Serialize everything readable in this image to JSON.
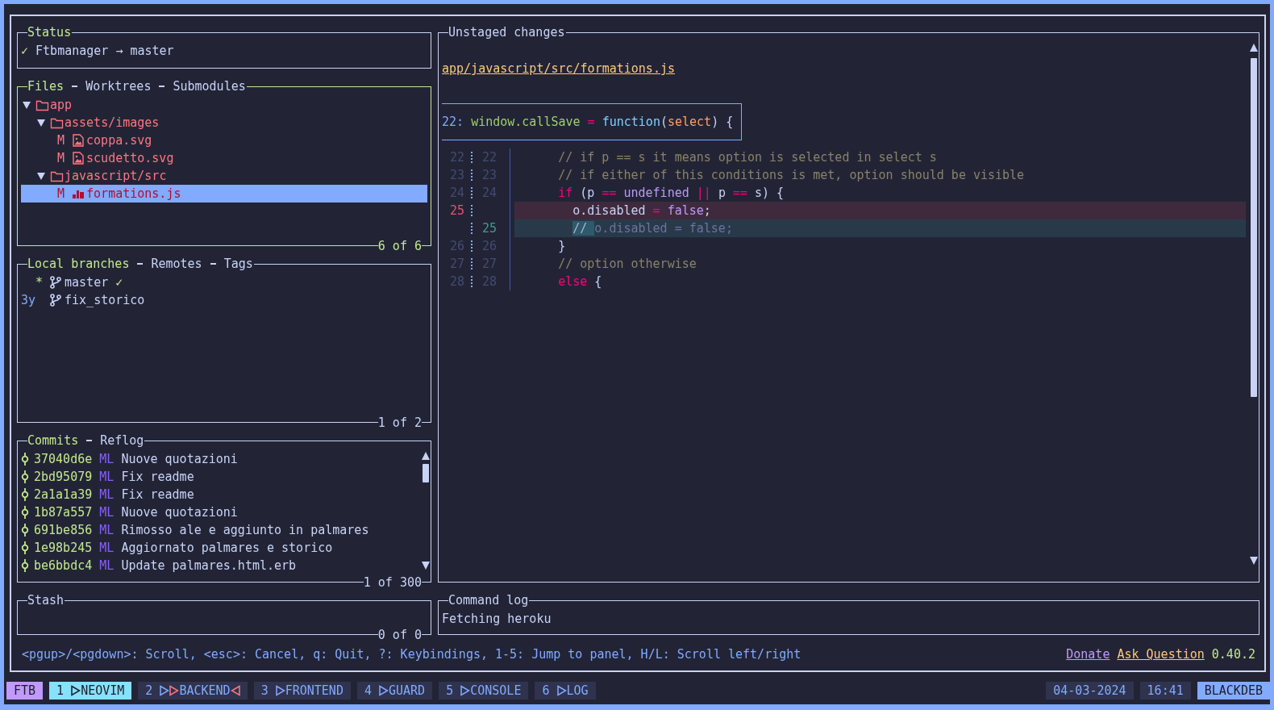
{
  "status_panel": {
    "tabs": [
      {
        "label": "Status",
        "selected": true
      }
    ],
    "focused": false,
    "check": "✓",
    "text": "Ftbmanager → master"
  },
  "files_panel": {
    "tabs": [
      {
        "label": "Files",
        "selected": true
      },
      {
        "label": "Worktrees",
        "selected": false
      },
      {
        "label": "Submodules",
        "selected": false
      }
    ],
    "focused": true,
    "counter": "6 of 6",
    "tree": [
      {
        "kind": "folder",
        "name": "app",
        "expanded": true,
        "selected": false,
        "children": [
          {
            "kind": "folder",
            "name": "assets/images",
            "expanded": true,
            "selected": false,
            "children": [
              {
                "kind": "image",
                "status": "M",
                "name": "coppa.svg",
                "selected": false
              },
              {
                "kind": "image",
                "status": "M",
                "name": "scudetto.svg",
                "selected": false
              }
            ]
          },
          {
            "kind": "folder",
            "name": "javascript/src",
            "expanded": true,
            "selected": false,
            "children": [
              {
                "kind": "script",
                "status": "M",
                "name": "formations.js",
                "selected": true
              }
            ]
          }
        ]
      }
    ]
  },
  "branches_panel": {
    "tabs": [
      {
        "label": "Local branches",
        "selected": true
      },
      {
        "label": "Remotes",
        "selected": false
      },
      {
        "label": "Tags",
        "selected": false
      }
    ],
    "focused": false,
    "counter": "1 of 2",
    "branches": [
      {
        "marker": "*",
        "current": true,
        "name": "master",
        "check": "✓"
      },
      {
        "marker": "3y",
        "current": false,
        "name": "fix_storico"
      }
    ]
  },
  "commits_panel": {
    "tabs": [
      {
        "label": "Commits",
        "selected": true
      },
      {
        "label": "Reflog",
        "selected": false
      }
    ],
    "focused": false,
    "counter": "1 of 300",
    "commits": [
      {
        "hash": "37040d6e",
        "author": "ML",
        "message": "Nuove quotazioni"
      },
      {
        "hash": "2bd95079",
        "author": "ML",
        "message": "Fix readme"
      },
      {
        "hash": "2a1a1a39",
        "author": "ML",
        "message": "Fix readme"
      },
      {
        "hash": "1b87a557",
        "author": "ML",
        "message": "Nuove quotazioni"
      },
      {
        "hash": "691be856",
        "author": "ML",
        "message": "Rimosso ale e aggiunto in palmares"
      },
      {
        "hash": "1e98b245",
        "author": "ML",
        "message": "Aggiornato palmares e storico"
      },
      {
        "hash": "be6bbdc4",
        "author": "ML",
        "message": "Update palmares.html.erb"
      }
    ]
  },
  "stash_panel": {
    "tabs": [
      {
        "label": "Stash",
        "selected": false
      }
    ],
    "focused": false,
    "counter": "0 of 0"
  },
  "diff_panel": {
    "tabs": [
      {
        "label": "Unstaged changes",
        "selected": false
      }
    ],
    "focused": false,
    "file": "app/javascript/src/formations.js",
    "hunk_header": {
      "line": "22:",
      "code": [
        {
          "text": "window.callSave",
          "kind": "function"
        },
        {
          "text": " = ",
          "kind": "operator"
        },
        {
          "text": "function",
          "kind": "builtin"
        },
        {
          "text": "("
        },
        {
          "text": "select",
          "kind": "param"
        },
        {
          "text": ") {"
        }
      ]
    },
    "lines": [
      {
        "kind": "context",
        "old": "22",
        "new": "22",
        "code": [
          {
            "text": "      // if p == s it means option is selected in select s",
            "kind": "comment"
          }
        ]
      },
      {
        "kind": "context",
        "old": "23",
        "new": "23",
        "code": [
          {
            "text": "      // if either of this conditions is met, option should be visible",
            "kind": "comment"
          }
        ]
      },
      {
        "kind": "context",
        "old": "24",
        "new": "24",
        "code": [
          {
            "text": "      if",
            "kind": "keyword"
          },
          {
            "text": " (p "
          },
          {
            "text": "== ",
            "kind": "operator"
          },
          {
            "text": "undefined ",
            "kind": "constant"
          },
          {
            "text": "|| ",
            "kind": "operator"
          },
          {
            "text": "p "
          },
          {
            "text": "== ",
            "kind": "operator"
          },
          {
            "text": "s) {"
          }
        ]
      },
      {
        "kind": "removed",
        "old": "25",
        "code": [
          {
            "text": "        o.disabled "
          },
          {
            "text": "= ",
            "kind": "operator"
          },
          {
            "text": "false",
            "kind": "constant"
          },
          {
            "text": ";"
          }
        ]
      },
      {
        "kind": "added",
        "new": "25",
        "code": [
          {
            "text": "        // ",
            "kind": "inline_change"
          },
          {
            "text": "o.disabled = false;",
            "kind": "dim"
          }
        ]
      },
      {
        "kind": "context",
        "old": "26",
        "new": "26",
        "code": [
          {
            "text": "      }"
          }
        ]
      },
      {
        "kind": "context",
        "old": "27",
        "new": "27",
        "code": [
          {
            "text": "      // option otherwise",
            "kind": "comment"
          }
        ]
      },
      {
        "kind": "context",
        "old": "28",
        "new": "28",
        "code": [
          {
            "text": "      else",
            "kind": "keyword"
          },
          {
            "text": " {"
          }
        ]
      }
    ]
  },
  "command_log_panel": {
    "tabs": [
      {
        "label": "Command log",
        "selected": false
      }
    ],
    "focused": false,
    "lines": [
      "Fetching heroku"
    ]
  },
  "help_bar": {
    "text": "<pgup>/<pgdown>: Scroll, <esc>: Cancel, q: Quit, ?: Keybindings, 1-5: Jump to panel, H/L: Scroll left/right",
    "links": [
      {
        "label": "Donate",
        "color": "#c099ff"
      },
      {
        "label": "Ask Question",
        "color": "#ffc777"
      }
    ],
    "version": "0.40.2"
  },
  "tmux_bar": {
    "session": "FTB",
    "windows": [
      {
        "index": "1",
        "name": "NEOVIM",
        "selected": true,
        "alert": false
      },
      {
        "index": "2",
        "name": "BACKEND",
        "selected": false,
        "alert": true
      },
      {
        "index": "3",
        "name": "FRONTEND",
        "selected": false,
        "alert": false
      },
      {
        "index": "4",
        "name": "GUARD",
        "selected": false,
        "alert": false
      },
      {
        "index": "5",
        "name": "CONSOLE",
        "selected": false,
        "alert": false
      },
      {
        "index": "6",
        "name": "LOG",
        "selected": false,
        "alert": false
      }
    ],
    "date": "04-03-2024",
    "time": "16:41",
    "host": "BLACKDEB"
  }
}
